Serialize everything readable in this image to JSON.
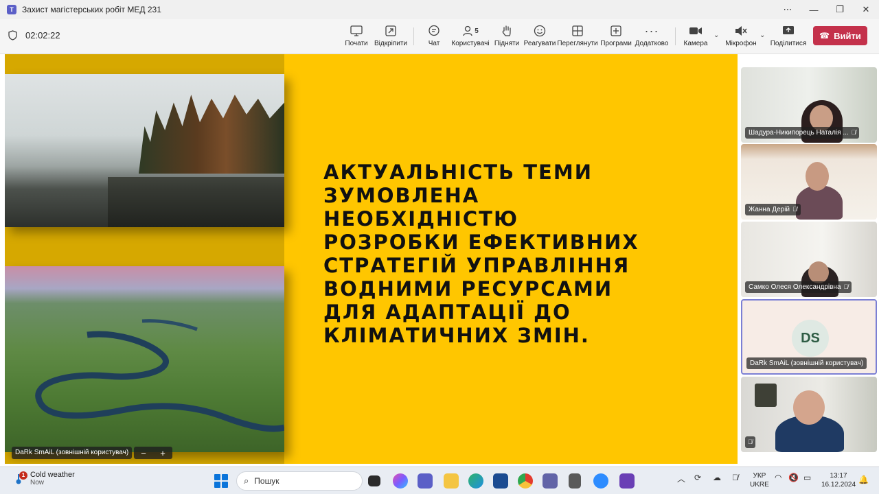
{
  "window": {
    "title": "Захист магістерських робіт МЕД 231",
    "app_logo": "T"
  },
  "toolbar": {
    "timer": "02:02:22",
    "items": [
      {
        "label": "Почати",
        "icon": "present-icon"
      },
      {
        "label": "Відкріпити",
        "icon": "unpin-icon"
      },
      {
        "label": "Чат",
        "icon": "chat-icon"
      },
      {
        "label": "Користувачі",
        "icon": "people-icon",
        "count": "5"
      },
      {
        "label": "Підняти",
        "icon": "raise-hand-icon"
      },
      {
        "label": "Реагувати",
        "icon": "emoji-icon"
      },
      {
        "label": "Переглянути",
        "icon": "view-icon"
      },
      {
        "label": "Програми",
        "icon": "apps-icon"
      },
      {
        "label": "Додатково",
        "icon": "more-icon"
      },
      {
        "label": "Камера",
        "icon": "camera-icon"
      },
      {
        "label": "Мікрофон",
        "icon": "mic-off-icon"
      },
      {
        "label": "Поділитися",
        "icon": "share-icon"
      }
    ],
    "leave_label": "Вийти"
  },
  "slide": {
    "lines": [
      "АКТУАЛЬНІСТЬ ТЕМИ",
      "ЗУМОВЛЕНА",
      "НЕОБХІДНІСТЮ",
      "РОЗРОБКИ ЕФЕКТИВНИХ",
      "СТРАТЕГІЙ УПРАВЛІННЯ",
      "ВОДНИМИ РЕСУРСАМИ",
      "ДЛЯ АДАПТАЦІЇ ДО",
      "КЛІМАТИЧНИХ ЗМІН."
    ],
    "background_color": "#ffc600",
    "sharer": "DaRk SmAiL (зовнішній користувач)",
    "zoom_out": "−",
    "zoom_in": "+"
  },
  "participants": [
    {
      "name": "Шадура-Никипорець Наталія ...",
      "muted": true
    },
    {
      "name": "Жанна Дерій",
      "muted": true
    },
    {
      "name": "Самко Олеся Олександрівна",
      "muted": true
    },
    {
      "name": "DaRk SmAiL (зовнішній користувач)",
      "initials": "DS",
      "muted": false
    },
    {
      "name": "",
      "muted": true
    }
  ],
  "taskbar": {
    "weather_title": "Cold weather",
    "weather_sub": "Now",
    "weather_badge": "1",
    "search_placeholder": "Пошук",
    "lang_line1": "УКР",
    "lang_line2": "UKRE",
    "time": "13:17",
    "date": "16.12.2024"
  }
}
